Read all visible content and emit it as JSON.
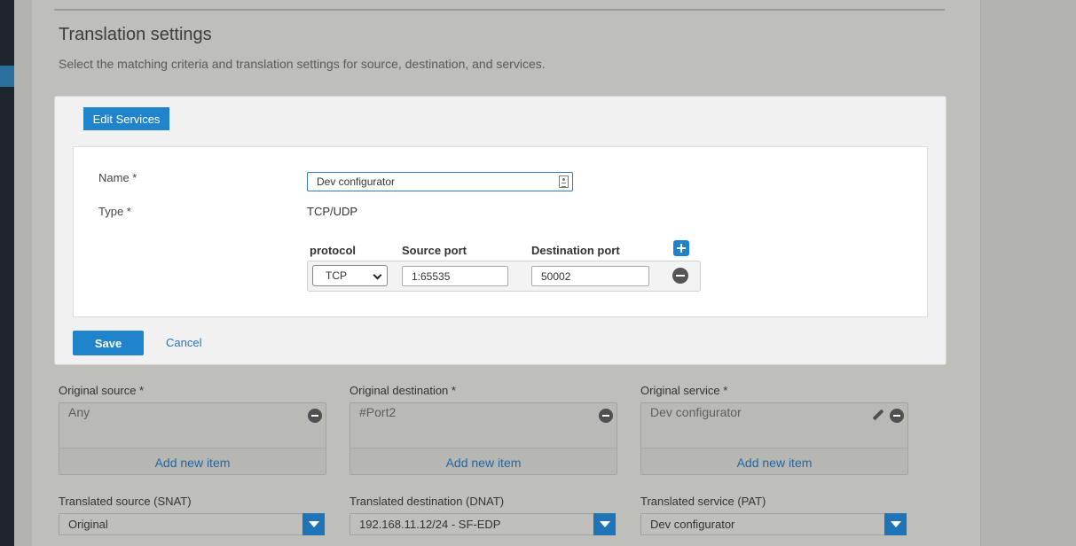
{
  "section": {
    "title": "Translation settings",
    "description": "Select the matching criteria and translation settings for source, destination, and services."
  },
  "dialog": {
    "title": "Edit Services",
    "name_label": "Name *",
    "name_value": "Dev configurator",
    "type_label": "Type *",
    "type_value": "TCP/UDP",
    "columns": {
      "protocol": "protocol",
      "source_port": "Source port",
      "destination_port": "Destination port"
    },
    "rows": [
      {
        "protocol": "TCP",
        "source_port": "1:65535",
        "destination_port": "50002"
      }
    ],
    "save_label": "Save",
    "cancel_label": "Cancel"
  },
  "criteria": [
    {
      "label": "Original source *",
      "item": "Any",
      "add_label": "Add new item"
    },
    {
      "label": "Original destination *",
      "item": "#Port2",
      "add_label": "Add new item"
    },
    {
      "label": "Original service *",
      "item": "Dev configurator",
      "add_label": "Add new item"
    }
  ],
  "translated": [
    {
      "label": "Translated source (SNAT)",
      "value": "Original"
    },
    {
      "label": "Translated destination (DNAT)",
      "value": "192.168.11.12/24 - SF-EDP"
    },
    {
      "label": "Translated service (PAT)",
      "value": "Dev configurator"
    }
  ],
  "colors": {
    "accent": "#1f84cc",
    "link": "#2a74b8",
    "nav": "#1c262c"
  }
}
